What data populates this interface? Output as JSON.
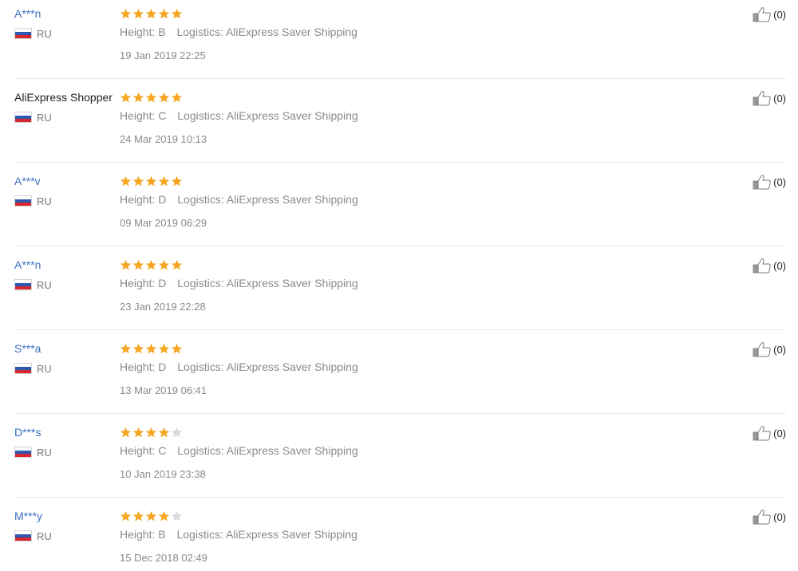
{
  "colors": {
    "star_filled": "#f5a623",
    "star_empty": "#d9d9d9",
    "username_link": "#3a6fc4",
    "meta_text": "#8a8a8a"
  },
  "reviews": [
    {
      "username": "A***n",
      "username_is_link": true,
      "country": "RU",
      "rating": 5,
      "height": "Height: B",
      "logistics": "Logistics: AliExpress Saver Shipping",
      "date": "19 Jan 2019 22:25",
      "likes": "(0)"
    },
    {
      "username": "AliExpress Shopper",
      "username_is_link": false,
      "country": "RU",
      "rating": 5,
      "height": "Height: C",
      "logistics": "Logistics: AliExpress Saver Shipping",
      "date": "24 Mar 2019 10:13",
      "likes": "(0)"
    },
    {
      "username": "A***v",
      "username_is_link": true,
      "country": "RU",
      "rating": 5,
      "height": "Height: D",
      "logistics": "Logistics: AliExpress Saver Shipping",
      "date": "09 Mar 2019 06:29",
      "likes": "(0)"
    },
    {
      "username": "A***n",
      "username_is_link": true,
      "country": "RU",
      "rating": 5,
      "height": "Height: D",
      "logistics": "Logistics: AliExpress Saver Shipping",
      "date": "23 Jan 2019 22:28",
      "likes": "(0)"
    },
    {
      "username": "S***a",
      "username_is_link": true,
      "country": "RU",
      "rating": 5,
      "height": "Height: D",
      "logistics": "Logistics: AliExpress Saver Shipping",
      "date": "13 Mar 2019 06:41",
      "likes": "(0)"
    },
    {
      "username": "D***s",
      "username_is_link": true,
      "country": "RU",
      "rating": 4,
      "height": "Height: C",
      "logistics": "Logistics: AliExpress Saver Shipping",
      "date": "10 Jan 2019 23:38",
      "likes": "(0)"
    },
    {
      "username": "M***y",
      "username_is_link": true,
      "country": "RU",
      "rating": 4,
      "height": "Height: B",
      "logistics": "Logistics: AliExpress Saver Shipping",
      "date": "15 Dec 2018 02:49",
      "likes": "(0)"
    }
  ]
}
